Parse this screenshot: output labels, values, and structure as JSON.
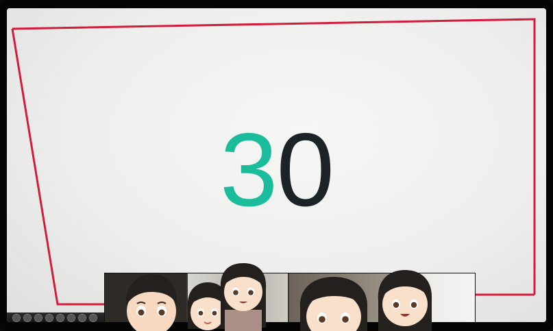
{
  "countdown": {
    "digit1": "3",
    "digit2": "0",
    "digit1_color": "#1bbc9b",
    "digit2_color": "#1c2326"
  },
  "slide": {
    "border_color": "#d21c3c",
    "background": "#f2f2f0"
  },
  "participants": {
    "count": 5,
    "icons": [
      "boy-avatar-icon",
      "girl-avatar-icon",
      "girl-avatar-icon",
      "girl-avatar-icon",
      "girl-avatar-icon"
    ]
  }
}
